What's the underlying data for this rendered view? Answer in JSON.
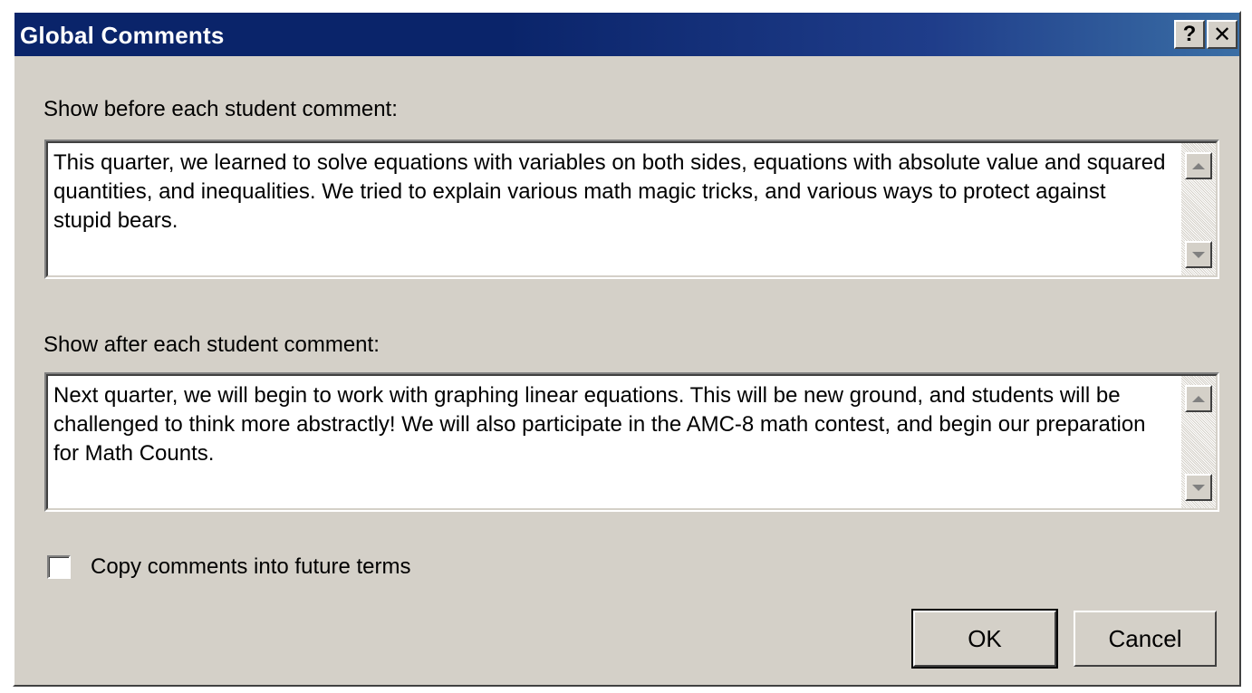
{
  "window": {
    "title": "Global Comments",
    "help_button": "?",
    "close_button": "✕"
  },
  "before": {
    "label": "Show before each student comment:",
    "text": "This quarter, we learned to solve equations with variables on both sides, equations with absolute value and squared quantities, and inequalities. We tried to explain various math magic tricks, and various ways to protect against stupid bears."
  },
  "after": {
    "label": "Show after each student comment:",
    "text": "Next quarter, we will begin to work with graphing linear equations. This will be new ground, and students will be challenged to think more abstractly! We will also participate in the AMC-8 math contest, and begin our preparation for Math Counts."
  },
  "options": {
    "copy_label": "Copy comments into future terms",
    "copy_checked": false
  },
  "buttons": {
    "ok": "OK",
    "cancel": "Cancel"
  },
  "colors": {
    "titlebar": "#0a246a",
    "face": "#d4d0c8"
  },
  "icons": {
    "help": "help-icon",
    "close": "close-icon",
    "scroll_up": "arrow-up-icon",
    "scroll_down": "arrow-down-icon"
  }
}
